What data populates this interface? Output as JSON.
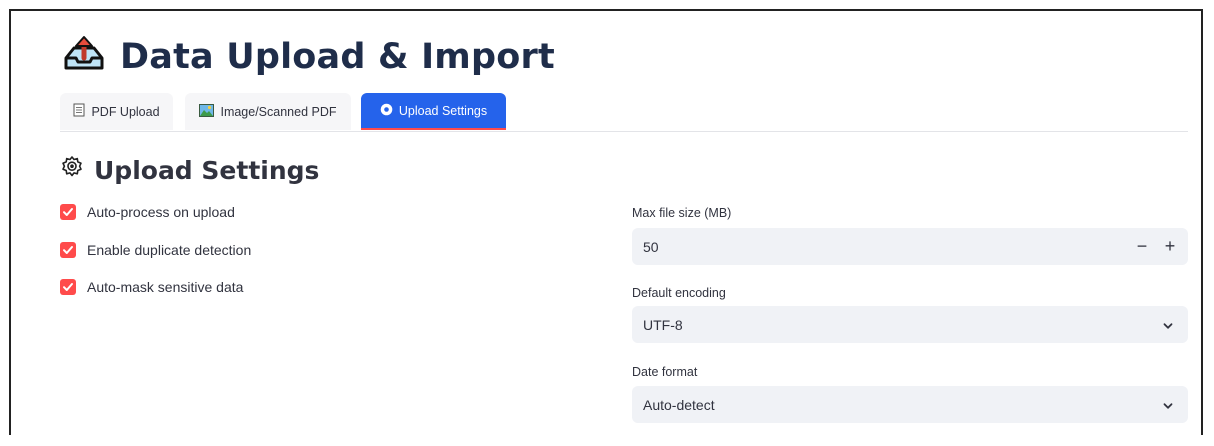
{
  "header": {
    "title": "Data Upload & Import",
    "title_icon": "upload-tray-icon"
  },
  "tabs": [
    {
      "label": "PDF Upload",
      "icon": "document-icon",
      "active": false
    },
    {
      "label": "Image/Scanned PDF",
      "icon": "picture-icon",
      "active": false
    },
    {
      "label": "Upload Settings",
      "icon": "gear-icon",
      "active": true
    }
  ],
  "section": {
    "title": "Upload Settings",
    "icon": "gear-outline-icon"
  },
  "options": [
    {
      "label": "Auto-process on upload",
      "checked": true
    },
    {
      "label": "Enable duplicate detection",
      "checked": true
    },
    {
      "label": "Auto-mask sensitive data",
      "checked": true
    }
  ],
  "max_file_size": {
    "label": "Max file size (MB)",
    "value": "50",
    "decrement": "−",
    "increment": "+"
  },
  "default_encoding": {
    "label": "Default encoding",
    "value": "UTF-8"
  },
  "date_format": {
    "label": "Date format",
    "value": "Auto-detect"
  },
  "colors": {
    "accent_red": "#ff4b4b",
    "active_tab": "#2563eb",
    "title": "#1f2d4a",
    "input_bg": "#f0f2f6"
  }
}
